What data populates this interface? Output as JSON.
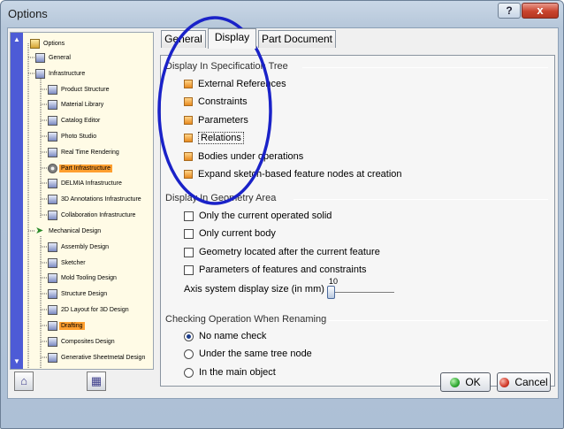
{
  "window": {
    "title": "Options",
    "help_label": "?",
    "close_label": "x"
  },
  "tree": {
    "scroll_up": "▲",
    "scroll_down": "▼",
    "items": [
      {
        "label": "Options"
      },
      {
        "label": "General"
      },
      {
        "label": "Infrastructure"
      },
      {
        "label": "Product Structure"
      },
      {
        "label": "Material Library"
      },
      {
        "label": "Catalog Editor"
      },
      {
        "label": "Photo Studio"
      },
      {
        "label": "Real Time Rendering"
      },
      {
        "label": "Part Infrastructure"
      },
      {
        "label": "DELMIA Infrastructure"
      },
      {
        "label": "3D Annotations Infrastructure"
      },
      {
        "label": "Collaboration Infrastructure"
      },
      {
        "label": "Mechanical Design"
      },
      {
        "label": "Assembly Design"
      },
      {
        "label": "Sketcher"
      },
      {
        "label": "Mold Tooling Design"
      },
      {
        "label": "Structure Design"
      },
      {
        "label": "2D Layout for 3D Design"
      },
      {
        "label": "Drafting"
      },
      {
        "label": "Composites Design"
      },
      {
        "label": "Generative Sheetmetal Design"
      }
    ]
  },
  "tabs": [
    {
      "label": "General"
    },
    {
      "label": "Display"
    },
    {
      "label": "Part Document"
    }
  ],
  "spec_tree": {
    "title": "Display In Specification Tree",
    "items": [
      {
        "label": "External References",
        "checked": true
      },
      {
        "label": "Constraints",
        "checked": true
      },
      {
        "label": "Parameters",
        "checked": true
      },
      {
        "label": "Relations",
        "checked": true
      },
      {
        "label": "Bodies under operations",
        "checked": true
      },
      {
        "label": "Expand sketch-based feature nodes at creation",
        "checked": true
      }
    ]
  },
  "geometry_area": {
    "title": "Display In Geometry Area",
    "items": [
      {
        "label": "Only the current operated solid",
        "checked": false
      },
      {
        "label": "Only current body",
        "checked": false
      },
      {
        "label": "Geometry located after the current feature",
        "checked": false
      },
      {
        "label": "Parameters of features and constraints",
        "checked": false
      }
    ],
    "axis_label": "Axis system display size (in mm)",
    "axis_value": "10",
    "axis_fraction": 0.0
  },
  "renaming": {
    "title": "Checking Operation When Renaming",
    "options": [
      {
        "label": "No name check",
        "selected": true
      },
      {
        "label": "Under the same tree node",
        "selected": false
      },
      {
        "label": "In the main object",
        "selected": false
      }
    ]
  },
  "buttons": {
    "ok": "OK",
    "cancel": "Cancel"
  },
  "colors": {
    "annotation": "#1a22c8",
    "ok": "#2fa832",
    "cancel": "#d23a2a",
    "selected_tree": "#ff9f2f"
  }
}
